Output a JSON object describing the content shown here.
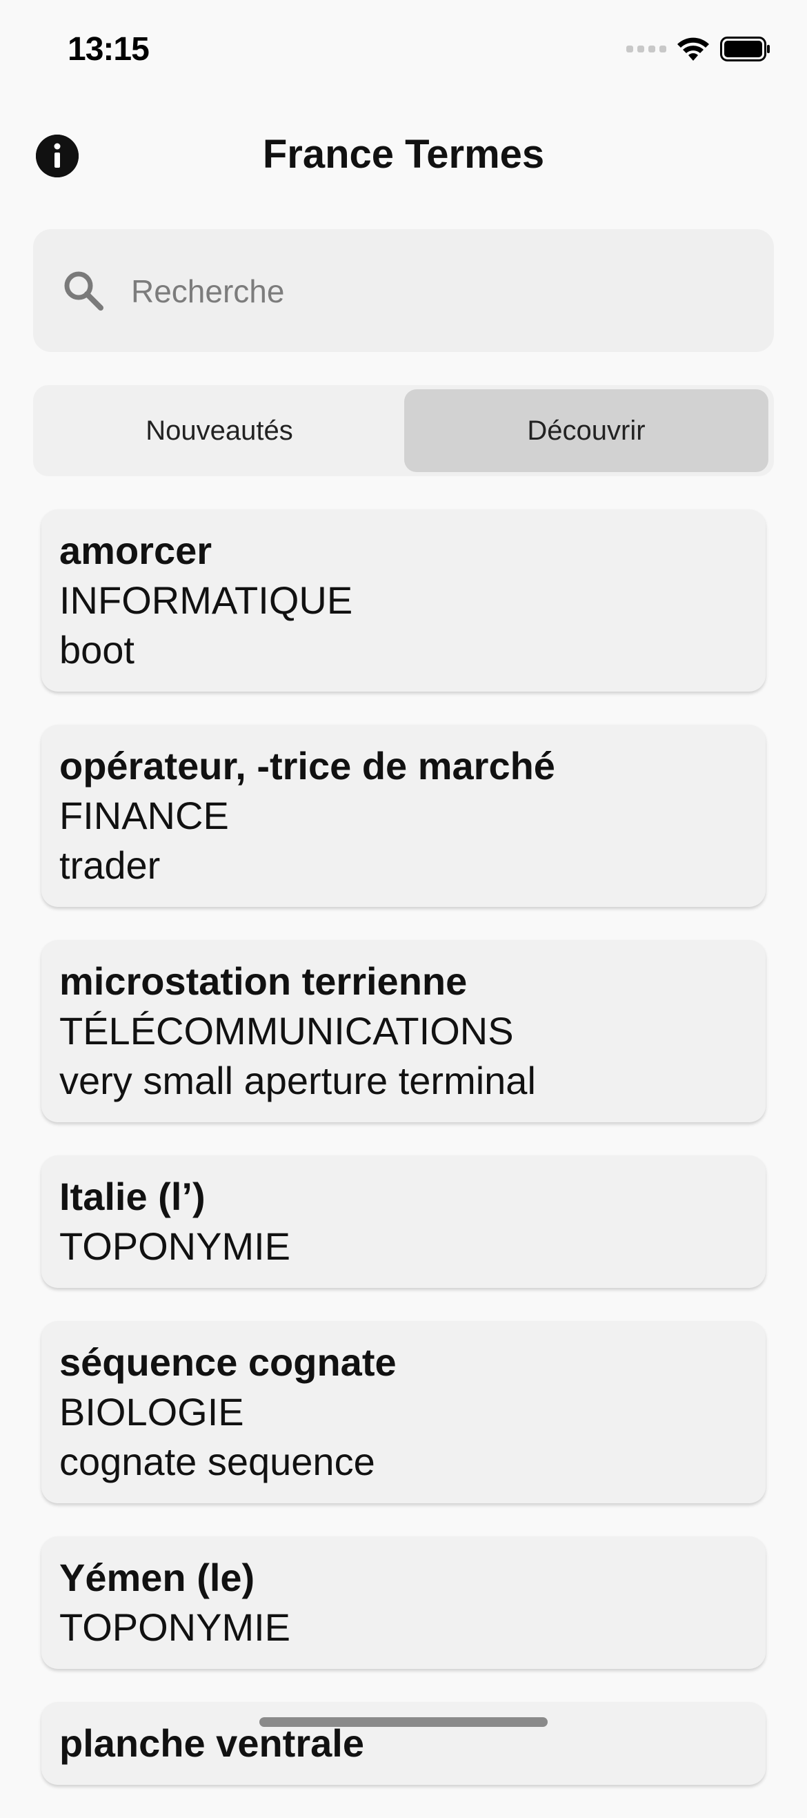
{
  "status_bar": {
    "time": "13:15"
  },
  "header": {
    "title": "France Termes"
  },
  "search": {
    "placeholder": "Recherche",
    "value": ""
  },
  "tabs": [
    {
      "label": "Nouveautés",
      "selected": false
    },
    {
      "label": "Découvrir",
      "selected": true
    }
  ],
  "entries": [
    {
      "term": "amorcer",
      "domain": "INFORMATIQUE",
      "equivalent": "boot"
    },
    {
      "term": "opérateur, -trice de marché",
      "domain": "FINANCE",
      "equivalent": "trader"
    },
    {
      "term": "microstation terrienne",
      "domain": "TÉLÉCOMMUNICATIONS",
      "equivalent": "very small aperture terminal"
    },
    {
      "term": "Italie (l’)",
      "domain": "TOPONYMIE",
      "equivalent": ""
    },
    {
      "term": "séquence cognate",
      "domain": "BIOLOGIE",
      "equivalent": "cognate sequence"
    },
    {
      "term": "Yémen (le)",
      "domain": "TOPONYMIE",
      "equivalent": ""
    },
    {
      "term": "planche ventrale",
      "domain": "",
      "equivalent": ""
    }
  ],
  "colors": {
    "background": "#f9f9f9",
    "card": "#f1f1f1",
    "selected_tab": "#d2d2d2"
  },
  "icons": {
    "info": "info-icon",
    "search": "search-icon",
    "wifi": "wifi-icon",
    "battery": "battery-icon"
  }
}
